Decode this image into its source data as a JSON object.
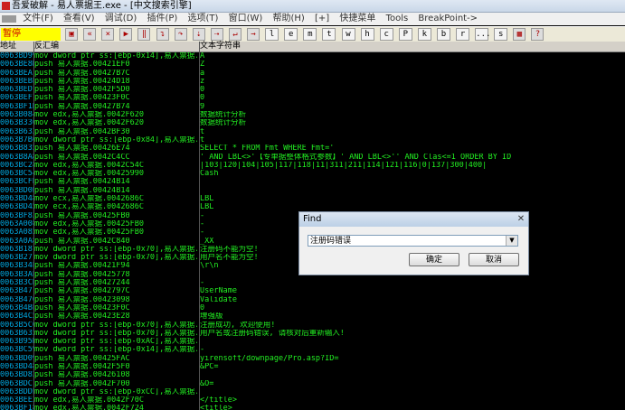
{
  "window": {
    "title": "吾爱破解 - 易人票据王.exe - [中文搜索引擎]"
  },
  "menu": [
    "文件(F)",
    "查看(V)",
    "调试(D)",
    "插件(P)",
    "选项(T)",
    "窗口(W)",
    "帮助(H)",
    "[+]",
    "快捷菜单",
    "Tools",
    "BreakPoint->"
  ],
  "toolbar": {
    "status": "暂停",
    "letters": [
      "l",
      "e",
      "m",
      "t",
      "w",
      "h",
      "c",
      "P",
      "k",
      "b",
      "r",
      "...",
      "s"
    ]
  },
  "columns": {
    "address": "地址",
    "disasm": "反汇编",
    "text": "文本字符串"
  },
  "rows": [
    {
      "addr": "0063BD99",
      "dis": "mov dword ptr ss:[ebp-0x14],易人票据.004",
      "text": "A"
    },
    {
      "addr": "0063BE8D",
      "dis": "push 易人票据.00421EF0",
      "text": "Z"
    },
    {
      "addr": "0063BEA1",
      "dis": "push 易人票据.00427B7C",
      "text": "a"
    },
    {
      "addr": "0063BEBE",
      "dis": "push 易人票据.00424D18",
      "text": "z"
    },
    {
      "addr": "0063BED7",
      "dis": "push 易人票据.0042F5D0",
      "text": "0"
    },
    {
      "addr": "0063BEF1",
      "dis": "push 易人票据.00423F0C",
      "text": "0"
    },
    {
      "addr": "0063BF1B",
      "dis": "push 易人票据.00427B74",
      "text": "9"
    },
    {
      "addr": "0063B084",
      "dis": "mov edx,易人票据.0042F620",
      "text": "数据统计分析"
    },
    {
      "addr": "0063B330",
      "dis": "mov edx,易人票据.0042F620",
      "text": "数据统计分析"
    },
    {
      "addr": "0063B632",
      "dis": "push 易人票据.0042BF30",
      "text": "t"
    },
    {
      "addr": "0063B7BC",
      "dis": "mov dword ptr ss:[ebp-0x84],易人票据.004",
      "text": "t"
    },
    {
      "addr": "0063B835",
      "dis": "push 易人票据.00426E74",
      "text": "SELECT * FROM Fmt WHERE Fmt='"
    },
    {
      "addr": "0063B8A8",
      "dis": "push 易人票据.0042C4CC",
      "text": "' AND LBL<>'【专单据整体格式参数】' AND LBL<>'' AND Clas<=1 ORDER BY ID"
    },
    {
      "addr": "0063BC28",
      "dis": "mov edx,易人票据.0042C54C",
      "text": "|103|120|104|105|117|118|11|311|211|114|121|116|0|137|300|400|"
    },
    {
      "addr": "0063BC54",
      "dis": "mov edx,易人票据.00425990",
      "text": "Cash"
    },
    {
      "addr": "0063BCFB",
      "dis": "push 易人票据.00424B14",
      "text": ""
    },
    {
      "addr": "0063BD0B",
      "dis": "push 易人票据.00424B14",
      "text": ""
    },
    {
      "addr": "0063BD48",
      "dis": "mov ecx,易人票据.0042686C",
      "text": "LBL"
    },
    {
      "addr": "0063BD45",
      "dis": "mov ecx,易人票据.0042686C",
      "text": "LBL"
    },
    {
      "addr": "0063BF83",
      "dis": "push 易人票据.00425FB0",
      "text": "-"
    },
    {
      "addr": "0063A008",
      "dis": "mov edx,易人票据.00425FB0",
      "text": "-"
    },
    {
      "addr": "0063A085",
      "dis": "mov edx,易人票据.00425FB0",
      "text": "-"
    },
    {
      "addr": "0063A0A8",
      "dis": "push 易人票据.0042C840",
      "text": "_XX"
    },
    {
      "addr": "0063B187",
      "dis": "mov dword ptr ss:[ebp-0x70],易人票据.004",
      "text": "注册码不能为空!"
    },
    {
      "addr": "0063B271",
      "dis": "mov dword ptr ss:[ebp-0x70],易人票据.004",
      "text": "用户名不能为空!"
    },
    {
      "addr": "0063B34E",
      "dis": "push 易人票据.00421F94",
      "text": "\\r\\n"
    },
    {
      "addr": "0063B3AE",
      "dis": "push 易人票据.00425778",
      "text": ""
    },
    {
      "addr": "0063B3CB",
      "dis": "push 易人票据.00427244",
      "text": "-"
    },
    {
      "addr": "0063B471",
      "dis": "push 易人票据.0042797C",
      "text": "UserName"
    },
    {
      "addr": "0063B476",
      "dis": "push 易人票据.00423098",
      "text": "Validate"
    },
    {
      "addr": "0063B4BE",
      "dis": "push 易人票据.00423F0C",
      "text": "0"
    },
    {
      "addr": "0063B4C5",
      "dis": "push 易人票据.00423E28",
      "text": "增强版"
    },
    {
      "addr": "0063B5C6",
      "dis": "mov dword ptr ss:[ebp-0x70],易人票据.004",
      "text": "注册成功, 欢迎使用!"
    },
    {
      "addr": "0063B635",
      "dis": "mov dword ptr ss:[ebp-0x70],易人票据.004",
      "text": "用户名或注册码错误, 请核对后重新输入!"
    },
    {
      "addr": "0063B95D",
      "dis": "mov dword ptr ss:[ebp-0xAC],易人票据.004",
      "text": ""
    },
    {
      "addr": "0063BC59",
      "dis": "mov dword ptr ss:[ebp-0x14],易人票据.004",
      "text": "-"
    },
    {
      "addr": "0063BD09",
      "dis": "push 易人票据.00425FAC",
      "text": "yirensoft/downpage/Pro.asp?ID="
    },
    {
      "addr": "0063BD48",
      "dis": "push 易人票据.0042F5F0",
      "text": "&PC="
    },
    {
      "addr": "0063BD82",
      "dis": "push 易人票据.00426108",
      "text": ""
    },
    {
      "addr": "0063BDC1",
      "dis": "push 易人票据.0042F700",
      "text": "&O="
    },
    {
      "addr": "0063BDDE",
      "dis": "mov dword ptr ss:[ebp-0xCC],易人票据.004",
      "text": ""
    },
    {
      "addr": "0063BEE3",
      "dis": "mov edx,易人票据.0042F70C",
      "text": "</title>"
    },
    {
      "addr": "0063BF18",
      "dis": "mov edx,易人票据.0042F724",
      "text": "<title>"
    }
  ],
  "find_dialog": {
    "title": "Find",
    "query": "注册码错误",
    "ok_label": "确定",
    "cancel_label": "取消"
  },
  "colors": {
    "green_text": "#22ee22",
    "address_text": "#00a8e0",
    "status_bg": "#ffff00",
    "status_text": "#cc0000"
  }
}
